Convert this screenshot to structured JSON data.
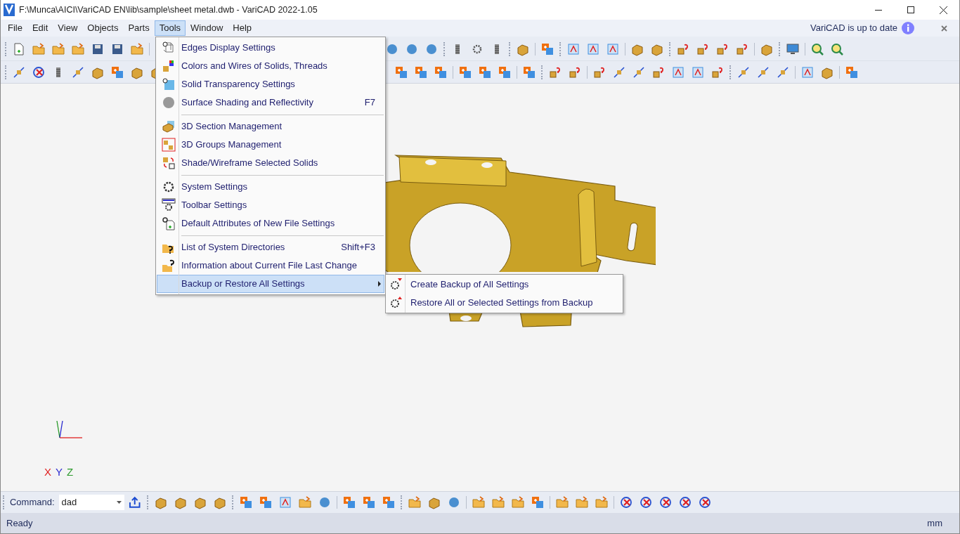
{
  "window": {
    "title": "F:\\Munca\\AICI\\VariCAD EN\\lib\\sample\\sheet metal.dwb - VariCAD 2022-1.05"
  },
  "menu_bar": [
    {
      "label": "File",
      "selected": false
    },
    {
      "label": "Edit",
      "selected": false
    },
    {
      "label": "View",
      "selected": false
    },
    {
      "label": "Objects",
      "selected": false
    },
    {
      "label": "Parts",
      "selected": false
    },
    {
      "label": "Tools",
      "selected": true
    },
    {
      "label": "Window",
      "selected": false
    },
    {
      "label": "Help",
      "selected": false
    }
  ],
  "update_notice": "VariCAD is up to date",
  "tools_menu": [
    {
      "kind": "item",
      "label": "Edges Display Settings",
      "selected": false
    },
    {
      "kind": "item",
      "label": "Colors and Wires of Solids, Threads",
      "selected": false
    },
    {
      "kind": "item",
      "label": "Solid Transparency Settings",
      "selected": false
    },
    {
      "kind": "item",
      "label": "Surface Shading and Reflectivity",
      "shortcut": "F7",
      "selected": false
    },
    {
      "kind": "separator"
    },
    {
      "kind": "item",
      "label": "3D Section Management",
      "selected": false
    },
    {
      "kind": "item",
      "label": "3D Groups Management",
      "selected": false
    },
    {
      "kind": "item",
      "label": "Shade/Wireframe Selected Solids",
      "selected": false
    },
    {
      "kind": "separator"
    },
    {
      "kind": "item",
      "label": "System Settings",
      "selected": false
    },
    {
      "kind": "item",
      "label": "Toolbar Settings",
      "selected": false
    },
    {
      "kind": "item",
      "label": "Default Attributes of New File Settings",
      "selected": false
    },
    {
      "kind": "separator"
    },
    {
      "kind": "item",
      "label": "List of System Directories",
      "shortcut": "Shift+F3",
      "selected": false
    },
    {
      "kind": "item",
      "label": "Information about Current File Last Change",
      "selected": false
    },
    {
      "kind": "item",
      "label": "Backup or Restore All Settings",
      "selected": true,
      "submenu": [
        {
          "label": "Create Backup of All Settings"
        },
        {
          "label": "Restore All or Selected Settings from Backup"
        }
      ]
    }
  ],
  "axes": {
    "x": "X",
    "y": "Y",
    "z": "Z"
  },
  "command_bar": {
    "label": "Command:",
    "value": "dad"
  },
  "status_bar": {
    "text": "Ready",
    "units": "mm"
  }
}
